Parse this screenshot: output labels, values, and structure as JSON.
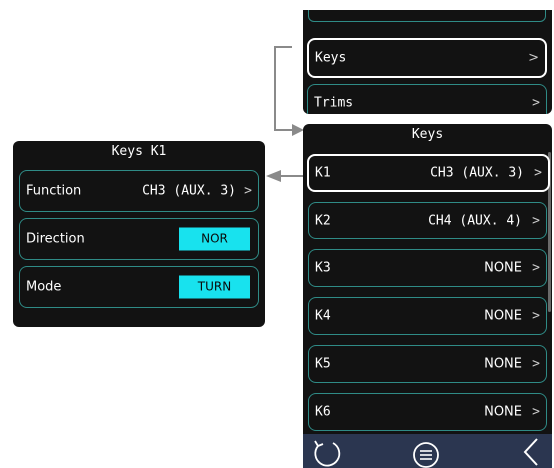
{
  "top_menu": {
    "partial_item": "Trims",
    "items": [
      {
        "label": "Keys",
        "chevron": ">"
      },
      {
        "label": "Trims",
        "chevron": ">"
      }
    ]
  },
  "keys_screen": {
    "title": "Keys",
    "rows": [
      {
        "key": "K1",
        "value": "CH3 (AUX. 3)",
        "chevron": ">"
      },
      {
        "key": "K2",
        "value": "CH4 (AUX. 4)",
        "chevron": ">"
      },
      {
        "key": "K3",
        "value": "NONE",
        "chevron": ">"
      },
      {
        "key": "K4",
        "value": "NONE",
        "chevron": ">"
      },
      {
        "key": "K5",
        "value": "NONE",
        "chevron": ">"
      },
      {
        "key": "K6",
        "value": "NONE",
        "chevron": ">"
      }
    ]
  },
  "k1_screen": {
    "title": "Keys K1",
    "function": {
      "label": "Function",
      "value": "CH3 (AUX. 3)",
      "chevron": ">"
    },
    "direction": {
      "label": "Direction",
      "value": "NOR"
    },
    "mode": {
      "label": "Mode",
      "value": "TURN"
    }
  },
  "bottom_bar": {
    "icons": [
      "refresh-icon",
      "menu-icon",
      "back-icon"
    ]
  },
  "colors": {
    "panel_bg": "#121212",
    "row_border": "#2f8b86",
    "pill_bg": "#18e2ee",
    "bottom_bar_bg": "#2b3650",
    "arrow": "#888888"
  }
}
